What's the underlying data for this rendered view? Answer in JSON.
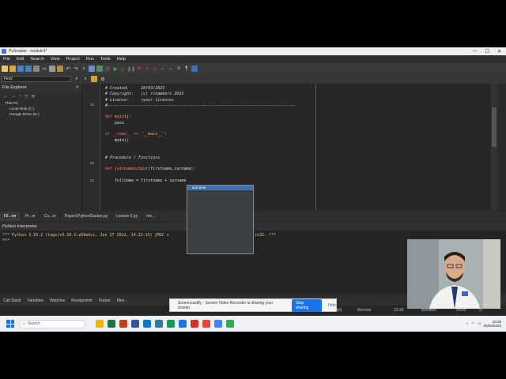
{
  "window": {
    "title": "PyScripter - module1*",
    "controls": [
      "—",
      "☐",
      "✕"
    ]
  },
  "menu": [
    "File",
    "Edit",
    "Search",
    "View",
    "Project",
    "Run",
    "Tools",
    "Help"
  ],
  "find": {
    "value": "Find:"
  },
  "file_explorer": {
    "title": "File Explorer",
    "close": "✕",
    "tree": [
      "This PC",
      "Local Disk (C:)",
      "Google Drive (G:)"
    ]
  },
  "editor": {
    "line_numbers": {
      "a": "10",
      "b": "20",
      "c": "21"
    },
    "lines": {
      "l1": "# Created:     28/03/2023",
      "l2": "# Copyright:   (c) rchambers 2023",
      "l3": "# Licence:     <your licence>",
      "l4": "#-------------------------------------------------------------------------------",
      "l5a": "def ",
      "l5b": "main",
      "l5c": "():",
      "l6": "    pass",
      "l7a": "if __name__ == ",
      "l7b": "'__main__'",
      "l7c": ":",
      "l8": "    main()",
      "l9": "# Procedure / Functions",
      "l10a": "def ",
      "l10b": "joinnameoutput",
      "l10c": "(firstname,surname):",
      "l11": "    fullname = firstname + surname"
    },
    "autocomplete": {
      "selected": "surname"
    }
  },
  "tabs": [
    "Fil...rer",
    "Pr...er",
    "Co...er",
    "Paper1PythonDastan.py",
    "Lesson 5.py",
    "mo..."
  ],
  "interpreter": {
    "title": "Python Interpreter",
    "output": "*** Python 3.10.2 (tags/v3.10.2:a58ebcc, Jan 17 2022, 14:12:15) [MSC v                                    in32. ***\n>>>"
  },
  "bottom_tabs": [
    "Call Stack",
    "Variables",
    "Watches",
    "Breakpoints",
    "Output",
    "Mes..."
  ],
  "status": {
    "col": "(Ixl)",
    "repl": "Remote",
    "pos": "23:35",
    "mode": "Modified",
    "insert": "Insert",
    "enc": "cr"
  },
  "share_banner": {
    "text": "Screencastify - Screen Video Recorder is sharing your screen.",
    "stop": "Stop sharing",
    "hide": "Hide"
  },
  "taskbar": {
    "search": "Search",
    "time": "10:36",
    "date": "28/03/2023",
    "apps": [
      "#f4b400",
      "#217346",
      "#c43e1c",
      "#2b579a",
      "#0078d4",
      "#2d7d9a",
      "#0f9d58",
      "#1a73e8",
      "#d93025",
      "#ea4335",
      "#4285f4",
      "#34a853"
    ]
  }
}
